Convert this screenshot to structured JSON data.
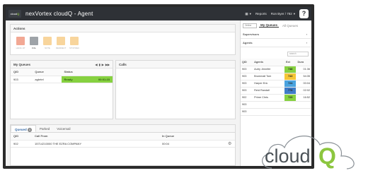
{
  "app": {
    "logo_text": "cloud",
    "logo_q": "Q",
    "title": "nexVortex cloudQ - Agent",
    "reports_label": "Reports",
    "user_label": "Ron Byer / 782",
    "help_glyph": "?"
  },
  "actions": {
    "title": "Actions",
    "buttons": [
      {
        "label": "HANG UP",
        "color": "#e8603c",
        "enabled": false
      },
      {
        "label": "DIAL",
        "color": "#9ea3a8",
        "enabled": true
      },
      {
        "label": "NOTE",
        "color": "#f3b24b",
        "enabled": false
      },
      {
        "label": "REDIRECT",
        "color": "#f3b24b",
        "enabled": false
      },
      {
        "label": "STOP REC",
        "color": "#f3b24b",
        "enabled": false
      }
    ]
  },
  "my_queues": {
    "title": "My Queues",
    "nav": [
      "◀",
      "▮",
      "▶",
      "▶▶"
    ],
    "columns": [
      "QID",
      "Queue",
      "Status"
    ],
    "rows": [
      {
        "qid": "903",
        "queue": "agbrtel",
        "status": "Ready",
        "time": "00:01:23"
      }
    ]
  },
  "calls": {
    "title": "Calls"
  },
  "bottom": {
    "tabs": [
      {
        "label": "Queued",
        "count": "1",
        "active": true
      },
      {
        "label": "Parked",
        "active": false
      },
      {
        "label": "Voicemail",
        "active": false
      }
    ],
    "columns": [
      "QID",
      "Call From",
      "In Queue"
    ],
    "rows": [
      {
        "qid": "902",
        "from": "15714210000 THE EZRA COMPANY",
        "in_queue": "00:04"
      }
    ]
  },
  "sidebar": {
    "status_label": "Online",
    "tabs": [
      {
        "label": "My Queues",
        "active": true
      },
      {
        "label": "All Queues",
        "active": false
      }
    ],
    "sections": [
      "Supervisors",
      "Agents"
    ],
    "search_placeholder": "search",
    "agent_columns": [
      "QID",
      "Agents",
      "Ext",
      "Dura"
    ],
    "agents": [
      {
        "qid": "903",
        "name": "Autry Jennifer",
        "ext": "748",
        "dur": "01:36",
        "color": "#86d140"
      },
      {
        "qid": "903",
        "name": "Brummall Tom",
        "ext": "743",
        "dur": "54:35",
        "color": "#f5c636"
      },
      {
        "qid": "903",
        "name": "Harper Eric",
        "ext": "724",
        "dur": "00:04",
        "color": "#4aa3df"
      },
      {
        "qid": "903",
        "name": "Reid Randall",
        "ext": "778",
        "dur": "02:02",
        "color": "#3f7cc8"
      },
      {
        "qid": "902",
        "name": "Prime Chris",
        "ext": "729",
        "dur": "16:52",
        "color": "#86d140"
      },
      {
        "qid": "903",
        "name": "",
        "ext": "",
        "dur": "",
        "color": ""
      },
      {
        "qid": "903",
        "name": "",
        "ext": "",
        "dur": "",
        "color": ""
      }
    ]
  },
  "brand": {
    "word": "cloud",
    "q": "Q",
    "word_color": "#4a5156",
    "q_color": "#8cc63f"
  }
}
